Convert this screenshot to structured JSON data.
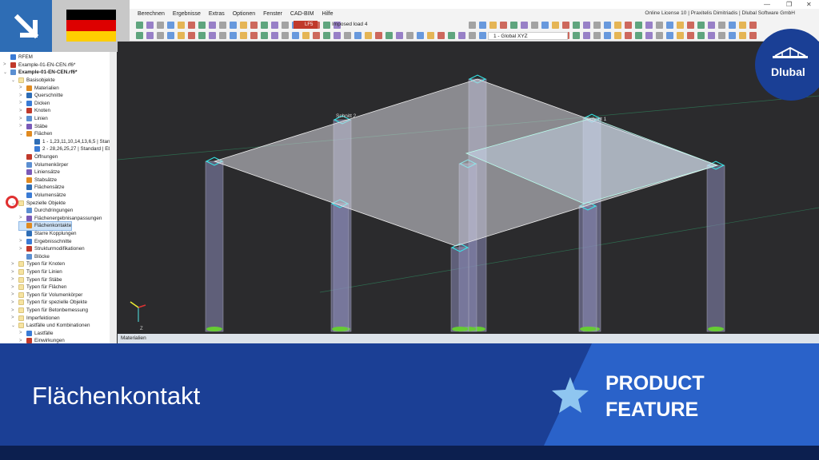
{
  "titlebar": {
    "license": "Online License 10 | Praxitelis Dimitriadis | Dlubal Software GmbH"
  },
  "menu": [
    "Berechnen",
    "Ergebnisse",
    "Extras",
    "Optionen",
    "Fenster",
    "CAD-BIM",
    "Hilfe"
  ],
  "toolbar": {
    "lc_badge": "LF5",
    "load_case": "Imposed load 4",
    "coord_system": "1 - Global XYZ"
  },
  "tree": {
    "items": [
      {
        "label": "RFEM",
        "level": 0,
        "exp": ""
      },
      {
        "label": "Example-01-EN-CEN.rf6*",
        "level": 0,
        "exp": ">"
      },
      {
        "label": "Example-01-EN-CEN.rf6*",
        "level": 0,
        "exp": "v",
        "bold": true
      },
      {
        "label": "Basisobjekte",
        "level": 1,
        "exp": "v",
        "folder": true
      },
      {
        "label": "Materialien",
        "level": 2,
        "exp": ">"
      },
      {
        "label": "Querschnitte",
        "level": 2,
        "exp": ">"
      },
      {
        "label": "Dicken",
        "level": 2,
        "exp": ">"
      },
      {
        "label": "Knoten",
        "level": 2,
        "exp": ">"
      },
      {
        "label": "Linien",
        "level": 2,
        "exp": ">"
      },
      {
        "label": "Stäbe",
        "level": 2,
        "exp": ">"
      },
      {
        "label": "Flächen",
        "level": 2,
        "exp": "v"
      },
      {
        "label": "1 - 1,23,11,10,14,13,6,5 | Stanc",
        "level": 3,
        "exp": ""
      },
      {
        "label": "2 - 28,26,25,27 | Standard | Eb",
        "level": 3,
        "exp": ""
      },
      {
        "label": "Öffnungen",
        "level": 2,
        "exp": ""
      },
      {
        "label": "Volumenkörper",
        "level": 2,
        "exp": ""
      },
      {
        "label": "Liniensätze",
        "level": 2,
        "exp": ""
      },
      {
        "label": "Stabsätze",
        "level": 2,
        "exp": ""
      },
      {
        "label": "Flächensätze",
        "level": 2,
        "exp": ""
      },
      {
        "label": "Volumensätze",
        "level": 2,
        "exp": ""
      },
      {
        "label": "Spezielle Objekte",
        "level": 1,
        "exp": "v",
        "folder": true
      },
      {
        "label": "Durchdringungen",
        "level": 2,
        "exp": ""
      },
      {
        "label": "Flächenergebnisanpassungen",
        "level": 2,
        "exp": ">"
      },
      {
        "label": "Flächenkontakte",
        "level": 2,
        "exp": "",
        "selected": true
      },
      {
        "label": "Starre Kopplungen",
        "level": 2,
        "exp": ""
      },
      {
        "label": "Ergebnisschnitte",
        "level": 2,
        "exp": ">"
      },
      {
        "label": "Strukturmodifikationen",
        "level": 2,
        "exp": ">"
      },
      {
        "label": "Blöcke",
        "level": 2,
        "exp": ""
      },
      {
        "label": "Typen für Knoten",
        "level": 1,
        "exp": ">",
        "folder": true
      },
      {
        "label": "Typen für Linien",
        "level": 1,
        "exp": ">",
        "folder": true
      },
      {
        "label": "Typen für Stäbe",
        "level": 1,
        "exp": ">",
        "folder": true
      },
      {
        "label": "Typen für Flächen",
        "level": 1,
        "exp": ">",
        "folder": true
      },
      {
        "label": "Typen für Volumenkörper",
        "level": 1,
        "exp": ">",
        "folder": true
      },
      {
        "label": "Typen für spezielle Objekte",
        "level": 1,
        "exp": ">",
        "folder": true
      },
      {
        "label": "Typen für Betonbemessung",
        "level": 1,
        "exp": ">",
        "folder": true
      },
      {
        "label": "Imperfektionen",
        "level": 1,
        "exp": ">",
        "folder": true
      },
      {
        "label": "Lastfälle und Kombinationen",
        "level": 1,
        "exp": "v",
        "folder": true
      },
      {
        "label": "Lastfälle",
        "level": 2,
        "exp": ">"
      },
      {
        "label": "Einwirkungen",
        "level": 2,
        "exp": ">"
      }
    ]
  },
  "view": {
    "section1": "Schnitt 1",
    "section2": "Schnitt 2",
    "axis_z": "Z"
  },
  "bottom_panel": {
    "title": "Materialien"
  },
  "banner": {
    "title": "Flächenkontakt",
    "product": "PRODUCT",
    "feature": "FEATURE",
    "logo": "Dlubal"
  },
  "colors": {
    "banner": "#1b3f95",
    "banner_accent": "#2a62c9",
    "footer": "#0c1f4f"
  }
}
